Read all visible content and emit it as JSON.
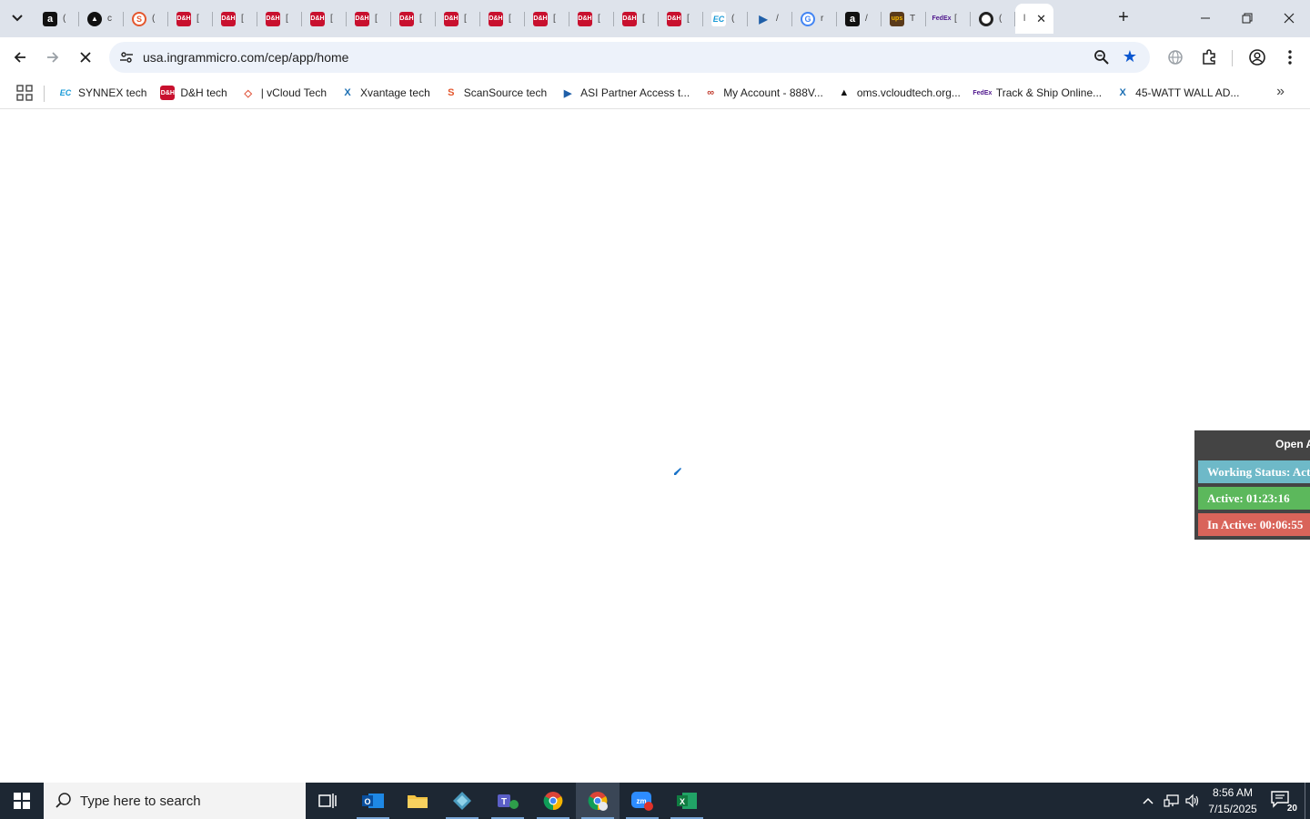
{
  "browser": {
    "tabs": [
      {
        "favicon": "amazon-icon",
        "letter": "a",
        "mini": "("
      },
      {
        "favicon": "triangle-logo-icon",
        "letter": "▲",
        "mini": "c"
      },
      {
        "favicon": "scansource-icon",
        "letter": "S",
        "mini": "("
      },
      {
        "favicon": "dh-icon",
        "letter": "D&H",
        "mini": "["
      },
      {
        "favicon": "dh-icon",
        "letter": "D&H",
        "mini": "["
      },
      {
        "favicon": "dh-icon",
        "letter": "D&H",
        "mini": "["
      },
      {
        "favicon": "dh-icon",
        "letter": "D&H",
        "mini": "["
      },
      {
        "favicon": "dh-icon",
        "letter": "D&H",
        "mini": "["
      },
      {
        "favicon": "dh-icon",
        "letter": "D&H",
        "mini": "["
      },
      {
        "favicon": "dh-icon",
        "letter": "D&H",
        "mini": "["
      },
      {
        "favicon": "dh-icon",
        "letter": "D&H",
        "mini": "["
      },
      {
        "favicon": "dh-icon",
        "letter": "D&H",
        "mini": "["
      },
      {
        "favicon": "dh-icon",
        "letter": "D&H",
        "mini": "["
      },
      {
        "favicon": "dh-icon",
        "letter": "D&H",
        "mini": "["
      },
      {
        "favicon": "dh-icon",
        "letter": "D&H",
        "mini": "["
      },
      {
        "favicon": "ec-icon",
        "letter": "EC",
        "mini": "("
      },
      {
        "favicon": "asi-arrow-icon",
        "letter": "▶",
        "mini": "/"
      },
      {
        "favicon": "google-icon",
        "letter": "G",
        "mini": "r"
      },
      {
        "favicon": "amazon-icon",
        "letter": "a",
        "mini": "/"
      },
      {
        "favicon": "ups-icon",
        "letter": "ups",
        "mini": "T"
      },
      {
        "favicon": "fedex-icon",
        "letter": "FedEx",
        "mini": "["
      },
      {
        "favicon": "ring-icon",
        "letter": "",
        "mini": "("
      }
    ],
    "active_tab": {
      "mini": "l"
    },
    "url": "usa.ingrammicro.com/cep/app/home",
    "bookmarks": [
      {
        "label": "SYNNEX tech",
        "icon": "ec-icon",
        "mark": "EC",
        "color": "#1a9bd7"
      },
      {
        "label": "D&H tech",
        "icon": "dh-icon",
        "mark": "D&H",
        "color": "#c8102e"
      },
      {
        "label": "| vCloud Tech",
        "icon": "vcloud-icon",
        "mark": "◇",
        "color": "#e0533a"
      },
      {
        "label": "Xvantage tech",
        "icon": "xvantage-icon",
        "mark": "X",
        "color": "#1c6fb3"
      },
      {
        "label": "ScanSource tech",
        "icon": "scansource-icon",
        "mark": "S",
        "color": "#e4572e"
      },
      {
        "label": "ASI Partner Access t...",
        "icon": "asi-arrow-icon",
        "mark": "▶",
        "color": "#1f5fa8"
      },
      {
        "label": "My Account - 888V...",
        "icon": "account-icon",
        "mark": "∞",
        "color": "#c0392b"
      },
      {
        "label": "oms.vcloudtech.org...",
        "icon": "triangle-logo-icon",
        "mark": "▲",
        "color": "#111111"
      },
      {
        "label": "Track & Ship Online...",
        "icon": "fedex-icon",
        "mark": "FedEx",
        "color": "#4d148c"
      },
      {
        "label": "45-WATT WALL AD...",
        "icon": "xvantage-icon",
        "mark": "X",
        "color": "#1c6fb3"
      }
    ]
  },
  "status_panel": {
    "open_label": "Open A",
    "working_status": "Working Status: Active",
    "active": "Active: 01:23:16",
    "inactive": "In Active: 00:06:55"
  },
  "taskbar": {
    "search_placeholder": "Type here to search",
    "time": "8:56 AM",
    "date": "7/15/2025",
    "notification_count": "20",
    "apps": [
      "task-view-icon",
      "outlook-icon",
      "file-explorer-icon",
      "app-diamond-icon",
      "teams-icon",
      "chrome-icon",
      "chrome-profile-icon",
      "zoom-icon",
      "excel-icon"
    ]
  },
  "colors": {
    "tabstrip": "#dee3eb",
    "omnibox": "#edf2fa",
    "accent": "#0b57d0",
    "status_working": "#6eb9c8",
    "status_active": "#5cb85c",
    "status_inactive": "#d9645a",
    "taskbar": "#1d2733"
  }
}
